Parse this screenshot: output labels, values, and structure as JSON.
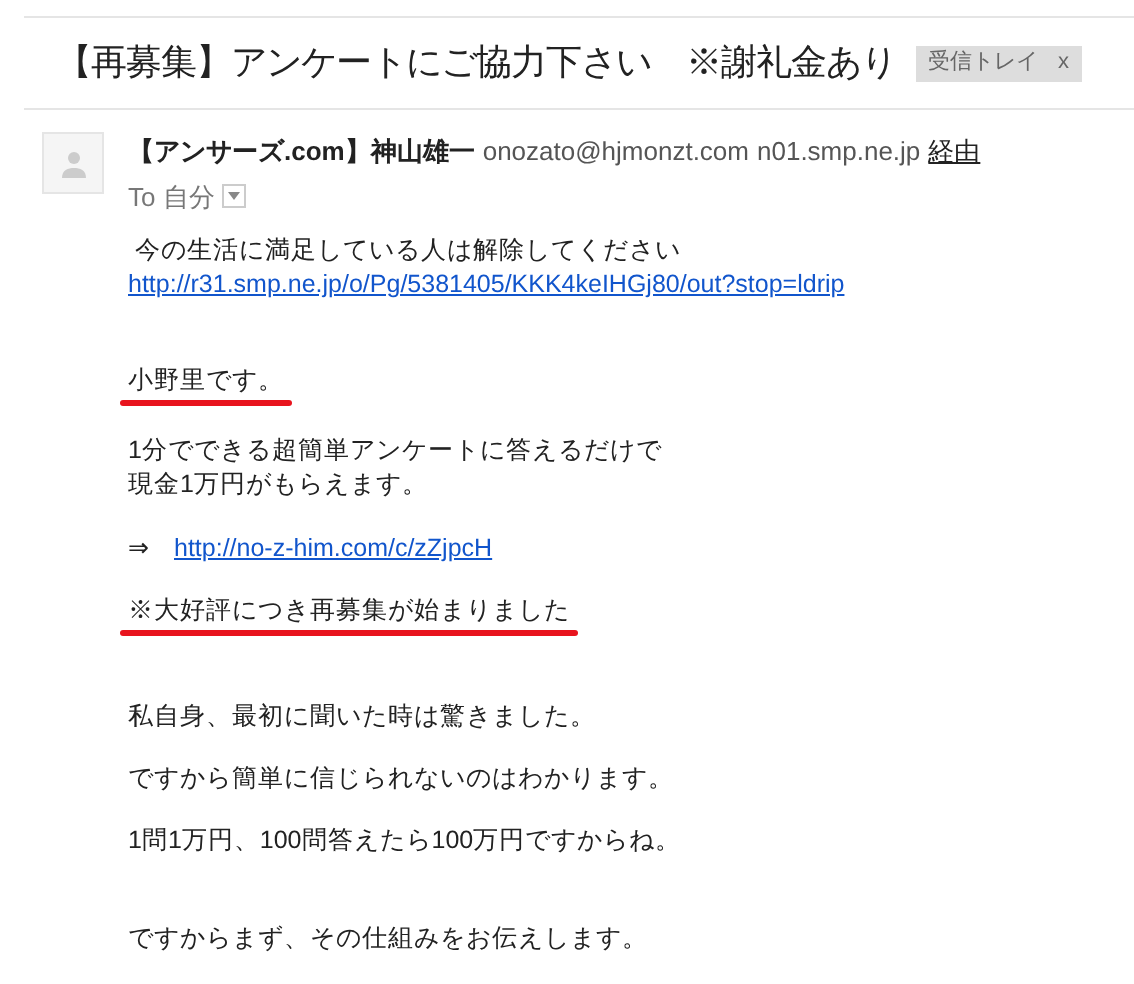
{
  "subject": "【再募集】アンケートにご協力下さい　※謝礼金あり",
  "label": {
    "text": "受信トレイ",
    "remove": "x"
  },
  "sender": {
    "name": "【アンサーズ.com】神山雄一",
    "email": "onozato@hjmonzt.com",
    "via_host": "n01.smp.ne.jp",
    "via": "経由"
  },
  "recipient": "To 自分",
  "body_sections": [
    {
      "blocks": [
        {
          "kind": "text",
          "lines": [
            " 今の生活に満足している人は解除してください"
          ],
          "marked": false
        },
        {
          "kind": "link",
          "lines": [
            "http://r31.smp.ne.jp/o/Pg/5381405/KKK4keIHGj80/out?stop=ldrip"
          ],
          "marked": false
        }
      ]
    },
    {
      "blocks": [
        {
          "kind": "text",
          "lines": [
            "小野里です。"
          ],
          "marked": true
        },
        {
          "kind": "text",
          "lines": [
            "1分でできる超簡単アンケートに答えるだけで",
            "現金1万円がもらえます。"
          ],
          "marked": false
        },
        {
          "kind": "arrow_link",
          "arrow": "⇒",
          "lines": [
            "http://no-z-him.com/c/zZjpcH"
          ],
          "marked": false
        },
        {
          "kind": "text",
          "lines": [
            "※大好評につき再募集が始まりました"
          ],
          "marked": true
        }
      ]
    },
    {
      "blocks": [
        {
          "kind": "text",
          "lines": [
            "私自身、最初に聞いた時は驚きました。"
          ],
          "marked": false
        },
        {
          "kind": "text",
          "lines": [
            "ですから簡単に信じられないのはわかります。"
          ],
          "marked": false
        },
        {
          "kind": "text",
          "lines": [
            "1問1万円、100問答えたら100万円ですからね。"
          ],
          "marked": false
        }
      ]
    },
    {
      "blocks": [
        {
          "kind": "text",
          "lines": [
            "ですからまず、その仕組みをお伝えします。"
          ],
          "marked": false
        }
      ]
    }
  ]
}
